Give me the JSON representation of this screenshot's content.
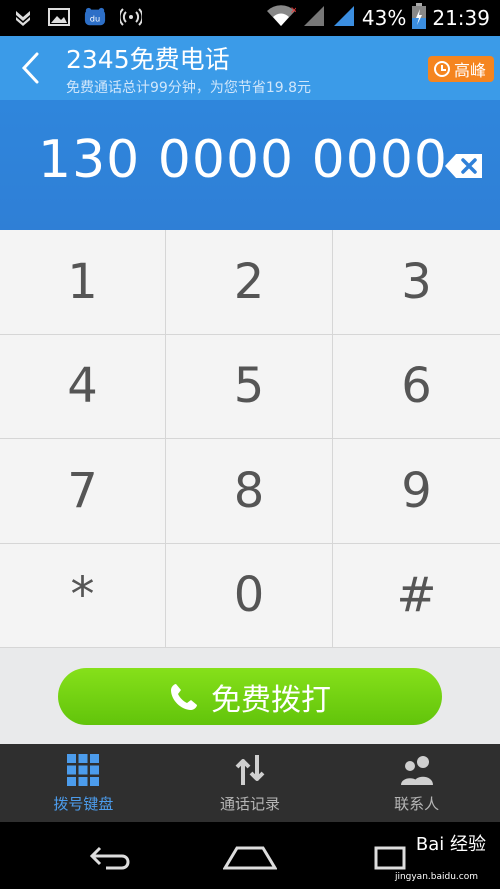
{
  "status_bar": {
    "battery": "43%",
    "time": "21:39"
  },
  "header": {
    "title": "2345免费电话",
    "subtitle": "免费通话总计99分钟，为您节省19.8元",
    "peak_label": "高峰"
  },
  "dialer": {
    "number": "130 0000 0000"
  },
  "keypad": {
    "keys": [
      "1",
      "2",
      "3",
      "4",
      "5",
      "6",
      "7",
      "8",
      "9",
      "*",
      "0",
      "#"
    ]
  },
  "call_button": {
    "label": "免费拨打"
  },
  "tabs": [
    {
      "label": "拨号键盘",
      "icon": "dialpad-icon",
      "active": true
    },
    {
      "label": "通话记录",
      "icon": "call-log-icon",
      "active": false
    },
    {
      "label": "联系人",
      "icon": "contacts-icon",
      "active": false
    }
  ],
  "watermark": {
    "brand": "Bai 经验",
    "url": "jingyan.baidu.com"
  },
  "colors": {
    "header": "#3b9be8",
    "display": "#2f80d8",
    "peak_badge": "#f5851f",
    "call_button": "#72d012",
    "tab_active": "#4c9cec",
    "tab_bar": "#2f2f2f"
  }
}
